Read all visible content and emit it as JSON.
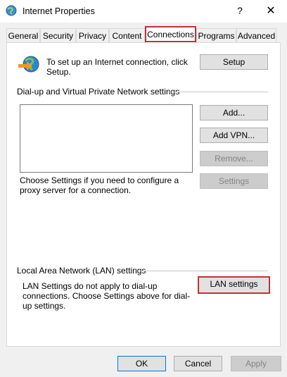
{
  "window": {
    "title": "Internet Properties",
    "help_label": "?",
    "close_label": "✕"
  },
  "tabs": [
    {
      "label": "General"
    },
    {
      "label": "Security"
    },
    {
      "label": "Privacy"
    },
    {
      "label": "Content"
    },
    {
      "label": "Connections"
    },
    {
      "label": "Programs"
    },
    {
      "label": "Advanced"
    }
  ],
  "active_tab": "Connections",
  "setup": {
    "text": "To set up an Internet connection, click Setup.",
    "button": "Setup"
  },
  "dialup": {
    "header": "Dial-up and Virtual Private Network settings",
    "add_button": "Add...",
    "add_vpn_button": "Add VPN...",
    "remove_button": "Remove...",
    "settings_button": "Settings",
    "proxy_text": "Choose Settings if you need to configure a proxy server for a connection."
  },
  "lan": {
    "header": "Local Area Network (LAN) settings",
    "text": "LAN Settings do not apply to dial-up connections. Choose Settings above for dial-up settings.",
    "button": "LAN settings"
  },
  "footer": {
    "ok": "OK",
    "cancel": "Cancel",
    "apply": "Apply"
  },
  "colors": {
    "highlight": "#c0323a",
    "focus_blue": "#0078d7"
  },
  "icons": {
    "app": "internet-globe-icon",
    "setup": "globe-network-icon"
  }
}
